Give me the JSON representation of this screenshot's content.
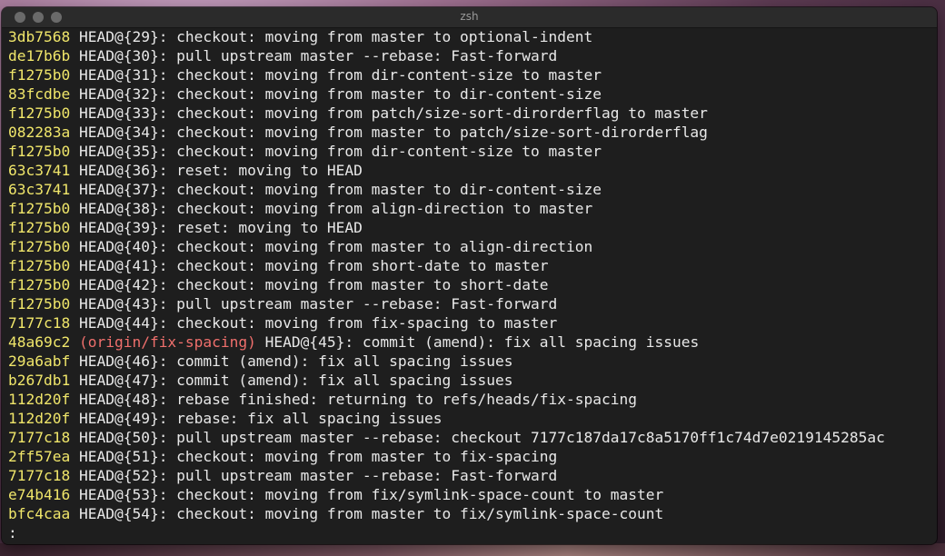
{
  "window": {
    "title": "zsh"
  },
  "colors": {
    "hash": "#f0e66a",
    "ref": "#ef6f6c",
    "text": "#e8e8e8",
    "background": "#1e1e1e"
  },
  "lines": [
    {
      "hash": "3db7568",
      "text": " HEAD@{29}: checkout: moving from master to optional-indent"
    },
    {
      "hash": "de17b6b",
      "text": " HEAD@{30}: pull upstream master --rebase: Fast-forward"
    },
    {
      "hash": "f1275b0",
      "text": " HEAD@{31}: checkout: moving from dir-content-size to master"
    },
    {
      "hash": "83fcdbe",
      "text": " HEAD@{32}: checkout: moving from master to dir-content-size"
    },
    {
      "hash": "f1275b0",
      "text": " HEAD@{33}: checkout: moving from patch/size-sort-dirorderflag to master"
    },
    {
      "hash": "082283a",
      "text": " HEAD@{34}: checkout: moving from master to patch/size-sort-dirorderflag"
    },
    {
      "hash": "f1275b0",
      "text": " HEAD@{35}: checkout: moving from dir-content-size to master"
    },
    {
      "hash": "63c3741",
      "text": " HEAD@{36}: reset: moving to HEAD"
    },
    {
      "hash": "63c3741",
      "text": " HEAD@{37}: checkout: moving from master to dir-content-size"
    },
    {
      "hash": "f1275b0",
      "text": " HEAD@{38}: checkout: moving from align-direction to master"
    },
    {
      "hash": "f1275b0",
      "text": " HEAD@{39}: reset: moving to HEAD"
    },
    {
      "hash": "f1275b0",
      "text": " HEAD@{40}: checkout: moving from master to align-direction"
    },
    {
      "hash": "f1275b0",
      "text": " HEAD@{41}: checkout: moving from short-date to master"
    },
    {
      "hash": "f1275b0",
      "text": " HEAD@{42}: checkout: moving from master to short-date"
    },
    {
      "hash": "f1275b0",
      "text": " HEAD@{43}: pull upstream master --rebase: Fast-forward"
    },
    {
      "hash": "7177c18",
      "text": " HEAD@{44}: checkout: moving from fix-spacing to master"
    },
    {
      "hash": "48a69c2",
      "ref": " (origin/fix-spacing)",
      "text": " HEAD@{45}: commit (amend): fix all spacing issues"
    },
    {
      "hash": "29a6abf",
      "text": " HEAD@{46}: commit (amend): fix all spacing issues"
    },
    {
      "hash": "b267db1",
      "text": " HEAD@{47}: commit (amend): fix all spacing issues"
    },
    {
      "hash": "112d20f",
      "text": " HEAD@{48}: rebase finished: returning to refs/heads/fix-spacing"
    },
    {
      "hash": "112d20f",
      "text": " HEAD@{49}: rebase: fix all spacing issues"
    },
    {
      "hash": "7177c18",
      "text": " HEAD@{50}: pull upstream master --rebase: checkout 7177c187da17c8a5170ff1c74d7e0219145285ac"
    },
    {
      "hash": "2ff57ea",
      "text": " HEAD@{51}: checkout: moving from master to fix-spacing"
    },
    {
      "hash": "7177c18",
      "text": " HEAD@{52}: pull upstream master --rebase: Fast-forward"
    },
    {
      "hash": "e74b416",
      "text": " HEAD@{53}: checkout: moving from fix/symlink-space-count to master"
    },
    {
      "hash": "bfc4caa",
      "text": " HEAD@{54}: checkout: moving from master to fix/symlink-space-count"
    }
  ],
  "prompt": ":"
}
